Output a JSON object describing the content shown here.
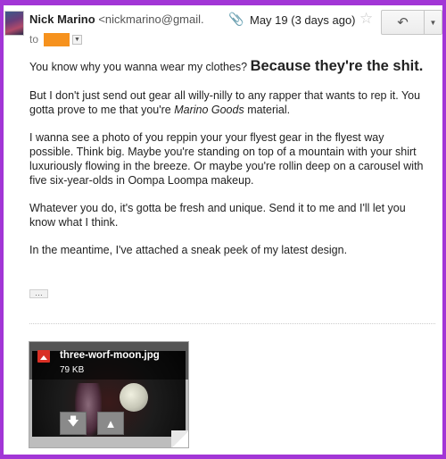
{
  "header": {
    "sender_name": "Nick Marino",
    "sender_email": "<nickmarino@gmail.",
    "to_label": "to",
    "date": "May 19 (3 days ago)",
    "attach_icon": "paperclip-icon",
    "star_icon": "star-icon",
    "reply_icon": "reply-icon",
    "more_icon": "chevron-down-icon"
  },
  "message": {
    "p1_text": "You know why you wanna wear my clothes? ",
    "p1_big": "Because they're the shit.",
    "p2_text": "But I don't just send out gear all willy-nilly to any rapper that wants to rep it. You gotta prove to me that you're ",
    "p2_italic": "Marino Goods",
    "p2_end": " material.",
    "p3": "I wanna see a photo of you reppin your your flyest gear in the flyest way possible. Think big. Maybe you're standing on top of a mountain with your shirt luxuriously flowing in the breeze. Or maybe you're rollin deep on a carousel with five six-year-olds in Oompa Loompa makeup.",
    "p4": "Whatever you do, it's gotta be fresh and unique. Send it to me and I'll let you know what I think.",
    "p5": "In the meantime, I've attached a sneak peek of my latest design.",
    "ellipsis": "…"
  },
  "attachment": {
    "filename": "three-worf-moon.jpg",
    "size": "79 KB",
    "filetype_icon": "image-file-icon",
    "download_icon": "download-icon",
    "drive_icon": "drive-icon"
  },
  "colors": {
    "frame": "#a236d6",
    "redacted": "#f6921e"
  }
}
